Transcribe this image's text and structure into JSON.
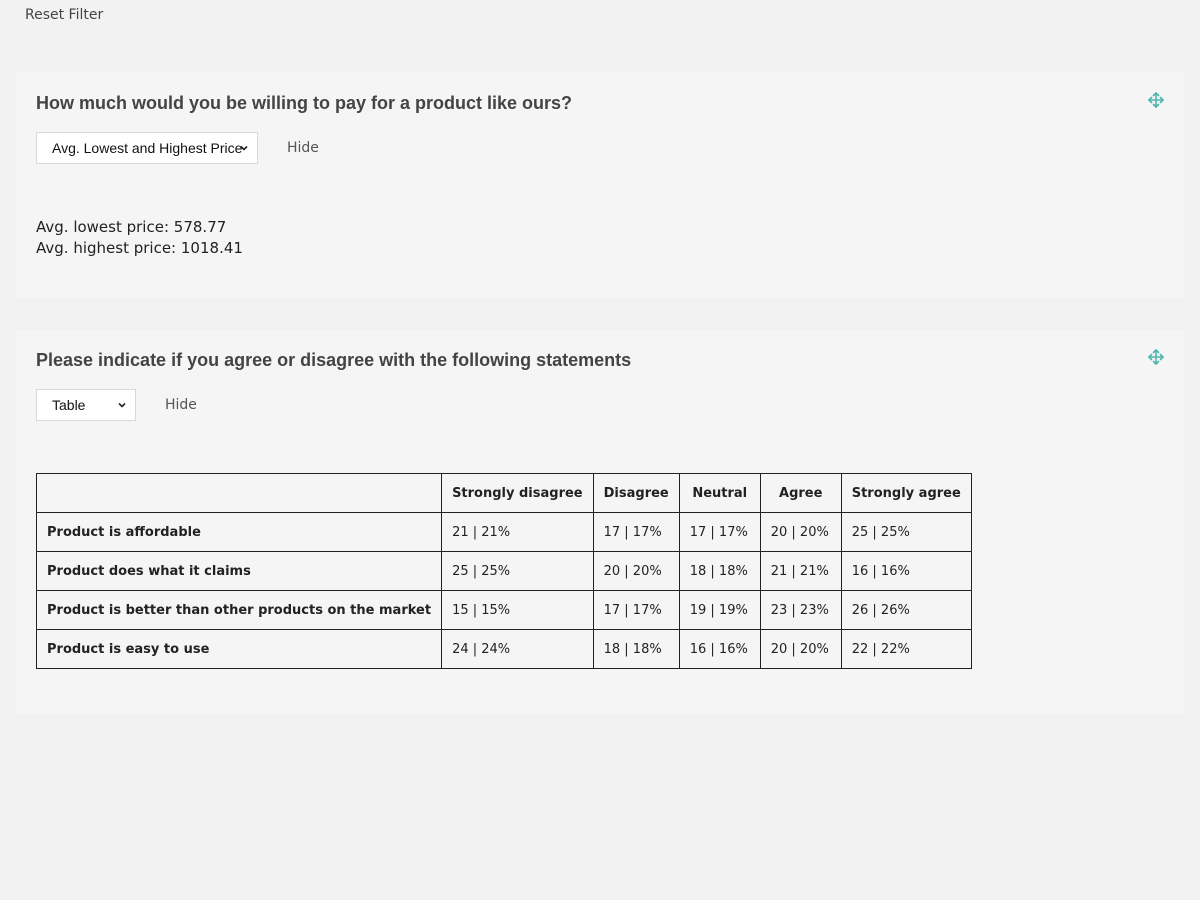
{
  "toolbar": {
    "reset_filter": "Reset Filter"
  },
  "question1": {
    "title": "How much would you be willing to pay for a product like ours?",
    "select_value": "Avg. Lowest and Highest Price",
    "hide_label": "Hide",
    "lowest_label": "Avg. lowest price:",
    "lowest_value": "578.77",
    "highest_label": "Avg. highest price:",
    "highest_value": "1018.41"
  },
  "question2": {
    "title": "Please indicate if you agree or disagree with the following statements",
    "select_value": "Table",
    "hide_label": "Hide",
    "columns": [
      "",
      "Strongly disagree",
      "Disagree",
      "Neutral",
      "Agree",
      "Strongly agree"
    ],
    "rows": [
      {
        "label": "Product is affordable",
        "cells": [
          "21 | 21%",
          "17 | 17%",
          "17 | 17%",
          "20 | 20%",
          "25 | 25%"
        ]
      },
      {
        "label": "Product does what it claims",
        "cells": [
          "25 | 25%",
          "20 | 20%",
          "18 | 18%",
          "21 | 21%",
          "16 | 16%"
        ]
      },
      {
        "label": "Product is better than other products on the market",
        "cells": [
          "15 | 15%",
          "17 | 17%",
          "19 | 19%",
          "23 | 23%",
          "26 | 26%"
        ]
      },
      {
        "label": "Product is easy to use",
        "cells": [
          "24 | 24%",
          "18 | 18%",
          "16 | 16%",
          "20 | 20%",
          "22 | 22%"
        ]
      }
    ]
  },
  "icons": {
    "move": "move-arrows-icon",
    "chevron": "chevron-down-icon"
  },
  "colors": {
    "accent": "#4db6ac",
    "card_bg": "#f5f5f5",
    "page_bg": "#f2f2f2"
  }
}
